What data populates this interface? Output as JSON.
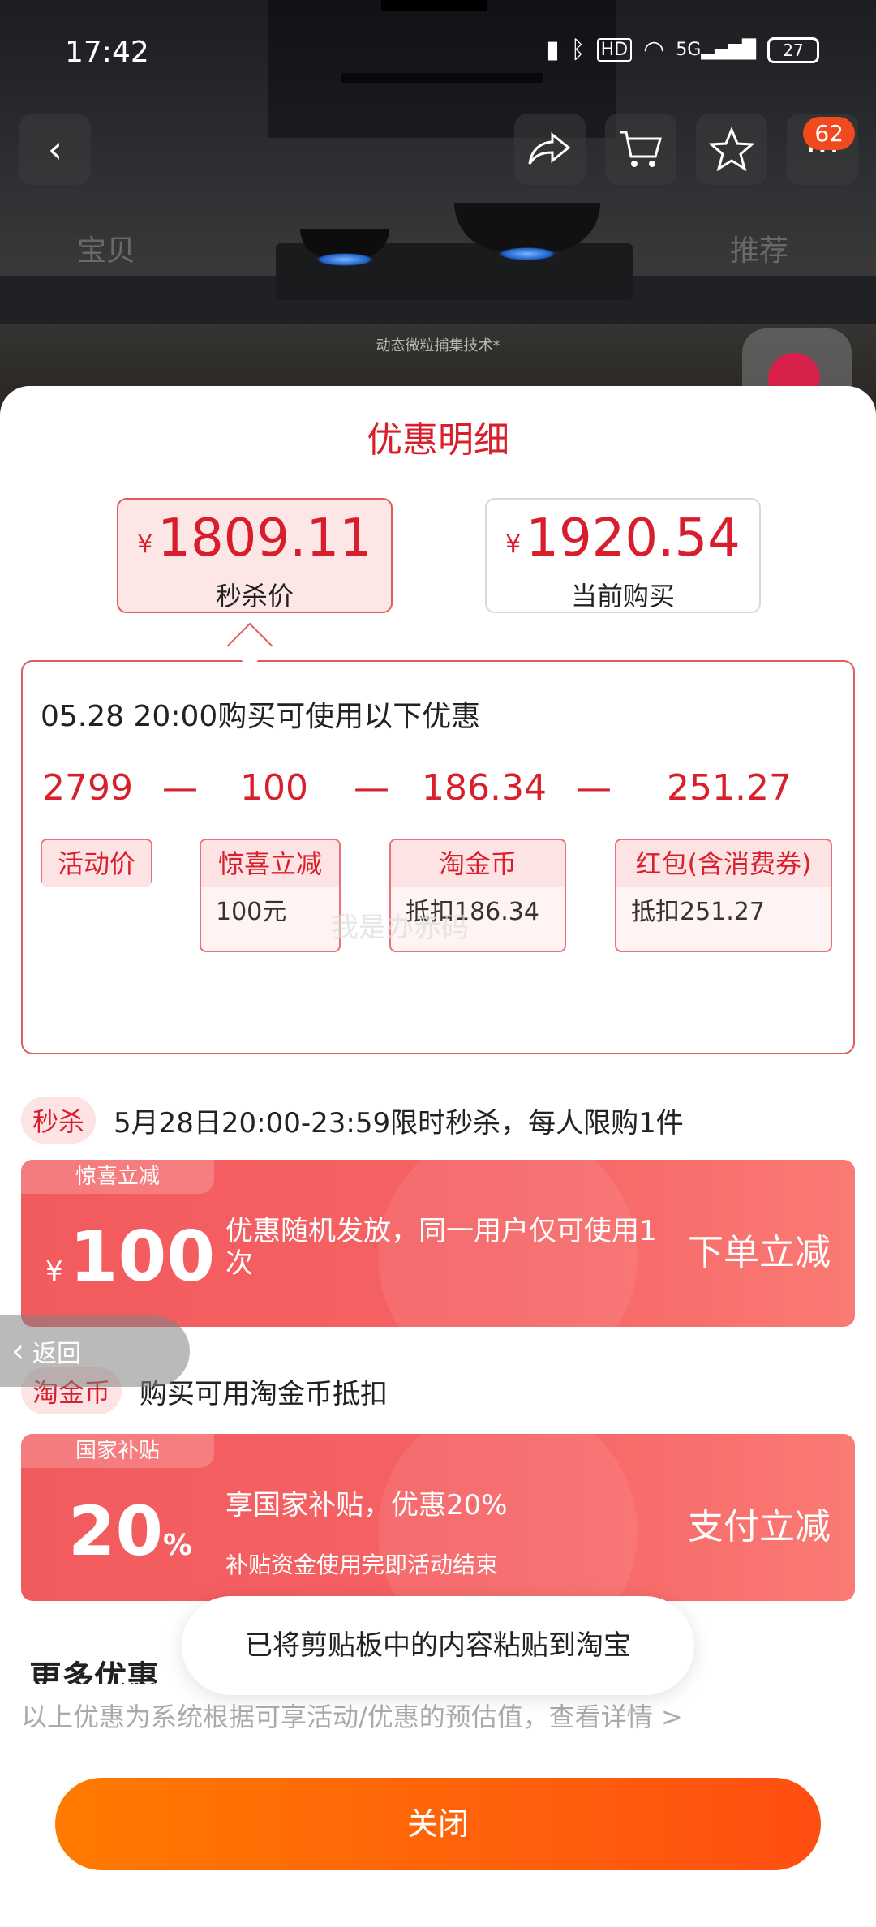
{
  "status_bar": {
    "time": "17:42",
    "battery": "27",
    "network": "5G",
    "hd": "HD"
  },
  "header": {
    "cart_badge": "62",
    "tab_left": "宝贝",
    "tab_right": "推荐",
    "photo_caption": "动态微粒捕集技术*"
  },
  "sheet": {
    "title": "优惠明细",
    "price_options": [
      {
        "currency": "¥",
        "amount": "1809.11",
        "label": "秒杀价",
        "selected": true
      },
      {
        "currency": "¥",
        "amount": "1920.54",
        "label": "当前购买",
        "selected": false
      }
    ],
    "detail": {
      "heading": "05.28 20:00购买可使用以下优惠",
      "calc": [
        "2799",
        "—",
        "100",
        "—",
        "186.34",
        "—",
        "251.27"
      ],
      "tags": [
        {
          "title": "活动价",
          "sub": ""
        },
        {
          "title": "惊喜立减",
          "sub": "100元"
        },
        {
          "title": "淘金币",
          "sub": "抵扣186.34"
        },
        {
          "title": "红包(含消费券)",
          "sub": "抵扣251.27"
        }
      ],
      "watermark": "我是办赤码"
    },
    "flash_sale": {
      "pill": "秒杀",
      "text": "5月28日20:00-23:59限时秒杀，每人限购1件"
    },
    "coupon_surprise": {
      "tag": "惊喜立减",
      "currency": "¥",
      "amount": "100",
      "desc": "优惠随机发放，同一用户仅可使用1次",
      "action": "下单立减"
    },
    "gold_coin": {
      "pill": "淘金币",
      "text": "购买可用淘金币抵扣"
    },
    "coupon_subsidy": {
      "tag": "国家补贴",
      "percent": "20",
      "percent_sign": "%",
      "desc": "享国家补贴，优惠20%",
      "desc2": "补贴资金使用完即活动结束",
      "action": "支付立减"
    },
    "more_title": "更多优惠",
    "footnote": "以上优惠为系统根据可享活动/优惠的预估值，查看详情 >",
    "close_label": "关闭"
  },
  "back_float": {
    "label": "返回"
  },
  "toast": {
    "text": "已将剪贴板中的内容粘贴到淘宝"
  },
  "colors": {
    "accent_red": "#d8202c",
    "coupon_red": "#f25b5e",
    "close_orange": "#ff7a00"
  }
}
